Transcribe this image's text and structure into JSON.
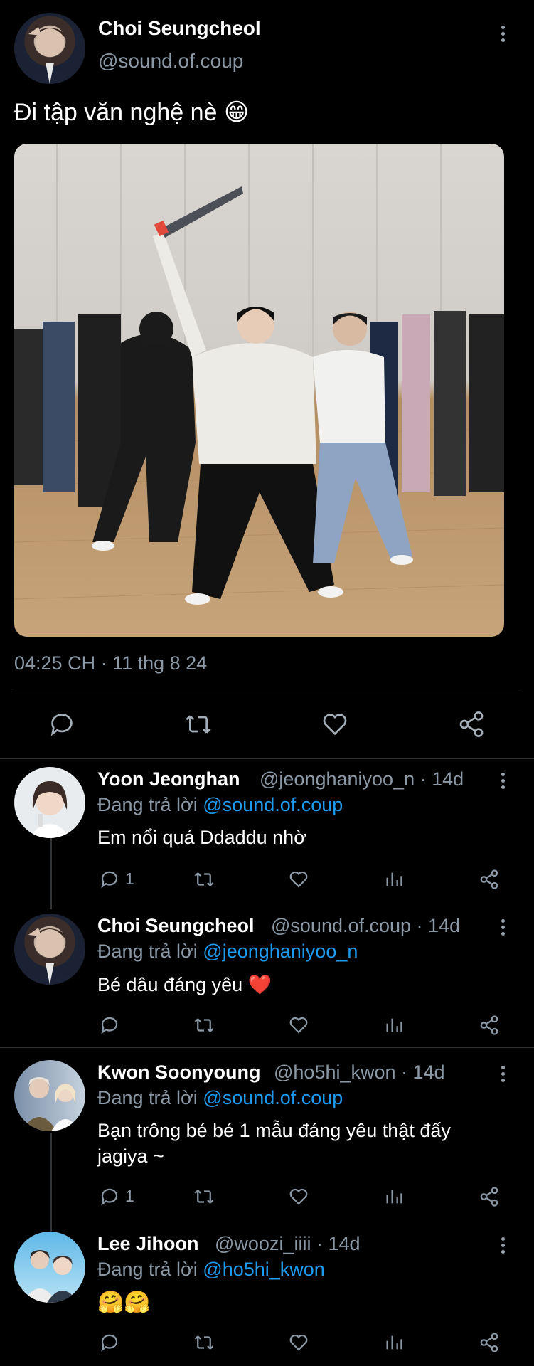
{
  "main_tweet": {
    "author_name": "Choi Seungcheol",
    "author_handle": "@sound.of.coup",
    "text": "Đi tập văn nghệ nè",
    "emoji": "😁",
    "timestamp": "04:25 CH · 11 thg 8 24",
    "image_alt": "Dance practice group photo"
  },
  "replies": [
    {
      "name": "Yoon Jeonghan",
      "meta": "@jeonghaniyoo_n · 14d",
      "replying_prefix": "Đang trả lời",
      "replying_to": "@sound.of.coup",
      "text": "Em nổi quá Ddaddu nhờ",
      "reply_count": "1"
    },
    {
      "name": "Choi Seungcheol",
      "meta": "@sound.of.coup · 14d",
      "replying_prefix": "Đang trả lời",
      "replying_to": "@jeonghaniyoo_n",
      "text": "Bé dâu đáng yêu",
      "emoji": "❤️",
      "reply_count": ""
    },
    {
      "name": "Kwon Soonyoung",
      "meta": "@ho5hi_kwon · 14d",
      "replying_prefix": "Đang trả lời",
      "replying_to": "@sound.of.coup",
      "text_line1": "Bạn trông bé bé 1 mẫu đáng yêu thật đấy",
      "text_line2": "jagiya ~",
      "reply_count": "1"
    },
    {
      "name": "Lee Jihoon",
      "meta": "@woozi_iiii · 14d",
      "replying_prefix": "Đang trả lời",
      "replying_to": "@ho5hi_kwon",
      "emoji": "🤗🤗",
      "reply_count": ""
    }
  ],
  "colors": {
    "background": "#000000",
    "link": "#1d9bf0",
    "secondary": "#8b98a5",
    "heart": "#e0245e"
  }
}
